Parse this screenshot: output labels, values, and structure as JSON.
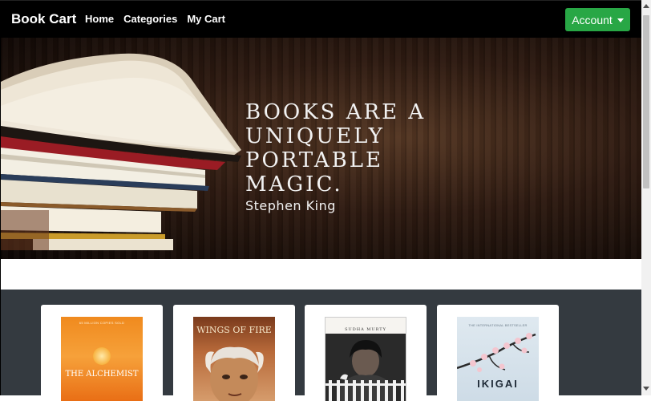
{
  "navbar": {
    "brand": "Book Cart",
    "links": [
      "Home",
      "Categories",
      "My Cart"
    ],
    "account_label": "Account"
  },
  "hero": {
    "quote_lines": [
      "BOOKS ARE A",
      "UNIQUELY",
      "PORTABLE",
      "MAGIC."
    ],
    "author": "Stephen King"
  },
  "books": [
    {
      "title": "THE ALCHEMIST",
      "tagline": "65 MILLION COPIES SOLD"
    },
    {
      "title": "WINGS OF FIRE",
      "tagline": ""
    },
    {
      "title": "",
      "author": "SUDHA MURTY"
    },
    {
      "title": "IKIGAI",
      "tagline": "THE INTERNATIONAL BESTSELLER"
    }
  ],
  "colors": {
    "navbar": "#000000",
    "account_button": "#28a745",
    "section_bg": "#343a40"
  }
}
